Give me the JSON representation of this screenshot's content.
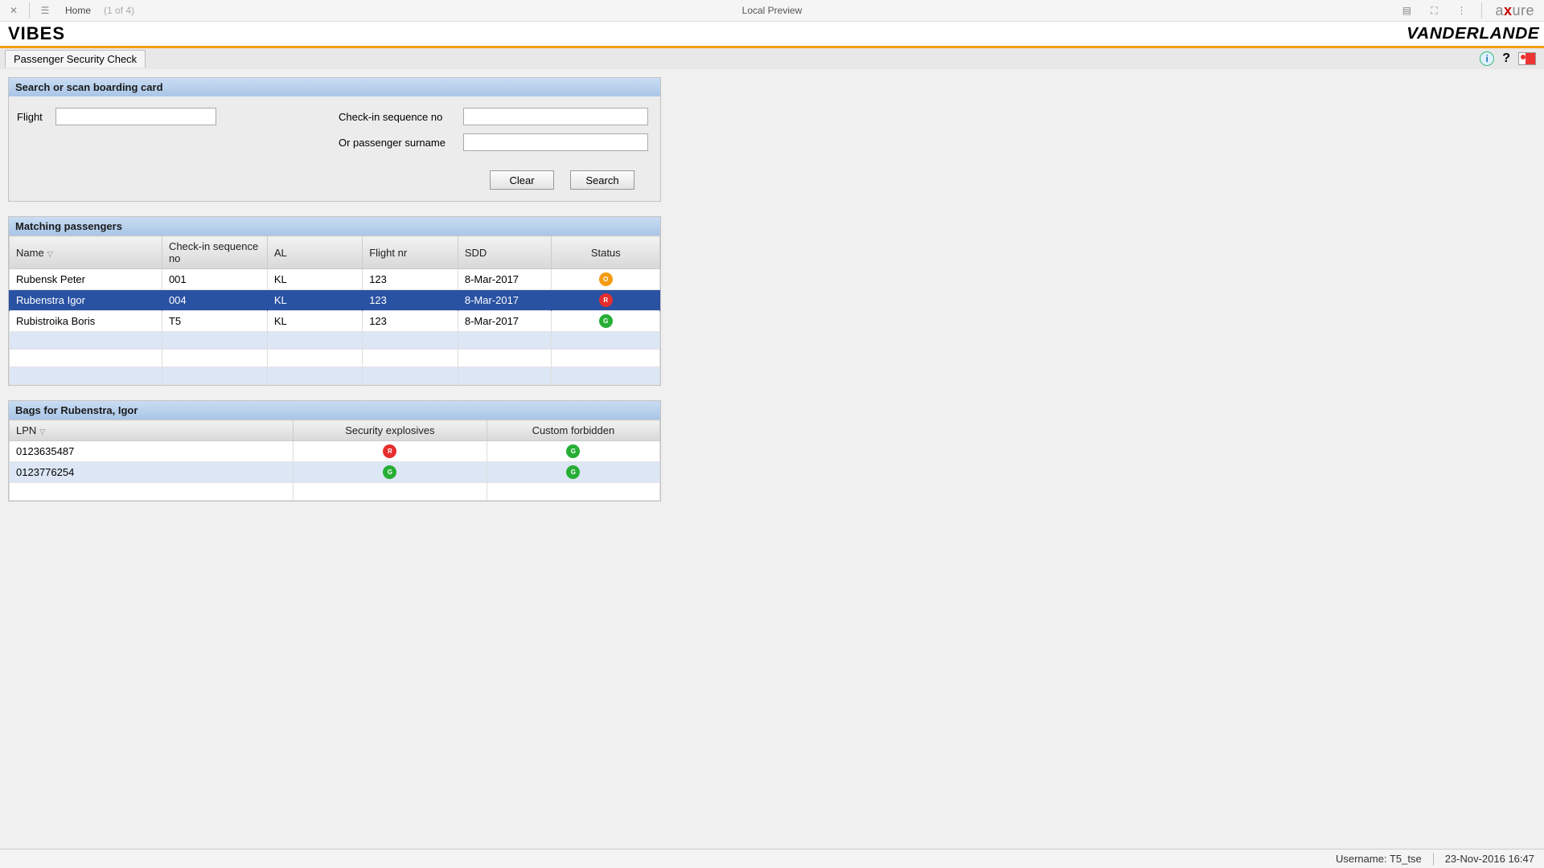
{
  "axbar": {
    "home": "Home",
    "count": "(1 of 4)",
    "center": "Local Preview",
    "logo_pre": "a",
    "logo_x": "x",
    "logo_post": "ure"
  },
  "app": {
    "title": "VIBES",
    "brand": "VANDERLANDE",
    "tab": "Passenger Security Check"
  },
  "search": {
    "title": "Search or scan boarding card",
    "flight_label": "Flight",
    "checkin_label": "Check-in sequence no",
    "surname_label": "Or passenger surname",
    "clear": "Clear",
    "search": "Search"
  },
  "matching": {
    "title": "Matching passengers",
    "cols": {
      "name": "Name",
      "checkin": "Check-in sequence no",
      "al": "AL",
      "flight": "Flight nr",
      "sdd": "SDD",
      "status": "Status"
    },
    "rows": [
      {
        "name": "Rubensk Peter",
        "checkin": "001",
        "al": "KL",
        "flight": "123",
        "sdd": "8-Mar-2017",
        "status": "O",
        "statusClass": "so",
        "sel": false
      },
      {
        "name": "Rubenstra Igor",
        "checkin": "004",
        "al": "KL",
        "flight": "123",
        "sdd": "8-Mar-2017",
        "status": "R",
        "statusClass": "sr",
        "sel": true
      },
      {
        "name": "Rubistroika Boris",
        "checkin": "T5",
        "al": "KL",
        "flight": "123",
        "sdd": "8-Mar-2017",
        "status": "G",
        "statusClass": "sg",
        "sel": false
      }
    ]
  },
  "bags": {
    "title": "Bags for Rubenstra, Igor",
    "cols": {
      "lpn": "LPN",
      "sec": "Security explosives",
      "cus": "Custom forbidden"
    },
    "rows": [
      {
        "lpn": "0123635487",
        "sec": "R",
        "secClass": "sr",
        "cus": "G",
        "cusClass": "sg"
      },
      {
        "lpn": "0123776254",
        "sec": "G",
        "secClass": "sg",
        "cus": "G",
        "cusClass": "sg"
      }
    ]
  },
  "footer": {
    "user_label": "Username: T5_tse",
    "datetime": "23-Nov-2016 16:47"
  }
}
